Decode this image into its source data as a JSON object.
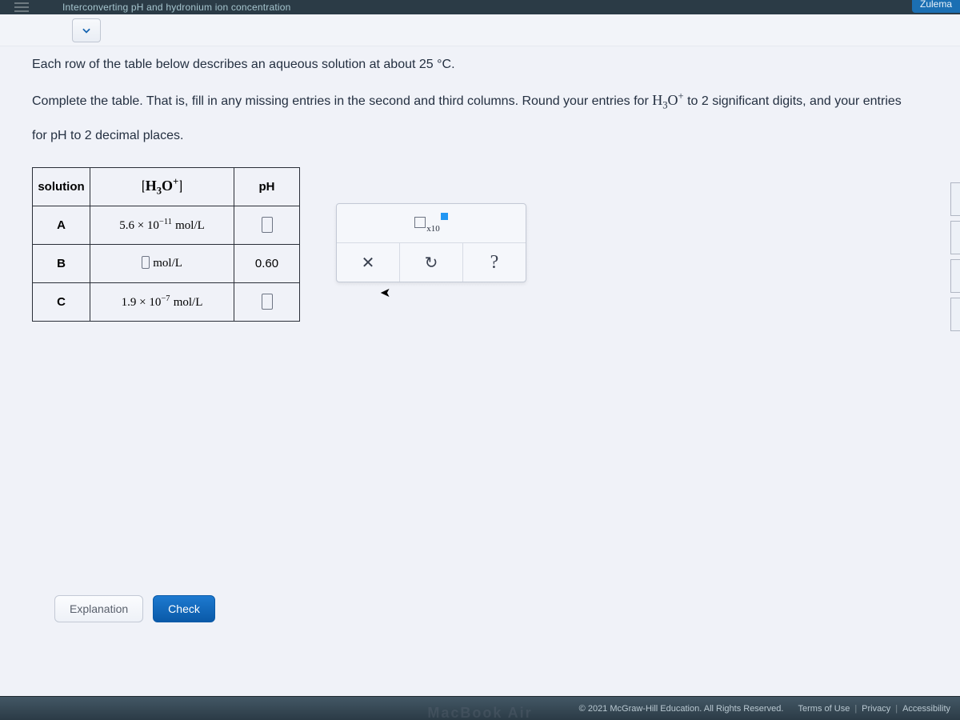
{
  "header": {
    "title": "Interconverting pH and hydronium ion concentration",
    "user": "Zulema"
  },
  "intro": {
    "line1": "Each row of the table below describes an aqueous solution at about 25 °C.",
    "line2_a": "Complete the table. That is, fill in any missing entries in the second and third columns. Round your entries for ",
    "line2_b": " to 2 significant digits, and your entries",
    "line3": "for pH to 2 decimal places."
  },
  "table": {
    "headers": {
      "solution": "solution",
      "conc": "[H₃O⁺]",
      "ph": "pH"
    },
    "rows": [
      {
        "label": "A",
        "conc_coeff": "5.6",
        "conc_exp": "−11",
        "unit": "mol/L",
        "ph": ""
      },
      {
        "label": "B",
        "conc_coeff": "",
        "conc_exp": "",
        "unit": "mol/L",
        "ph": "0.60"
      },
      {
        "label": "C",
        "conc_coeff": "1.9",
        "conc_exp": "−7",
        "unit": "mol/L",
        "ph": ""
      }
    ]
  },
  "palette": {
    "sci_x10": "x10",
    "close": "✕",
    "undo": "↻",
    "help": "?"
  },
  "buttons": {
    "explanation": "Explanation",
    "check": "Check"
  },
  "footer": {
    "copyright": "© 2021 McGraw-Hill Education. All Rights Reserved.",
    "terms": "Terms of Use",
    "privacy": "Privacy",
    "access": "Accessibility"
  }
}
